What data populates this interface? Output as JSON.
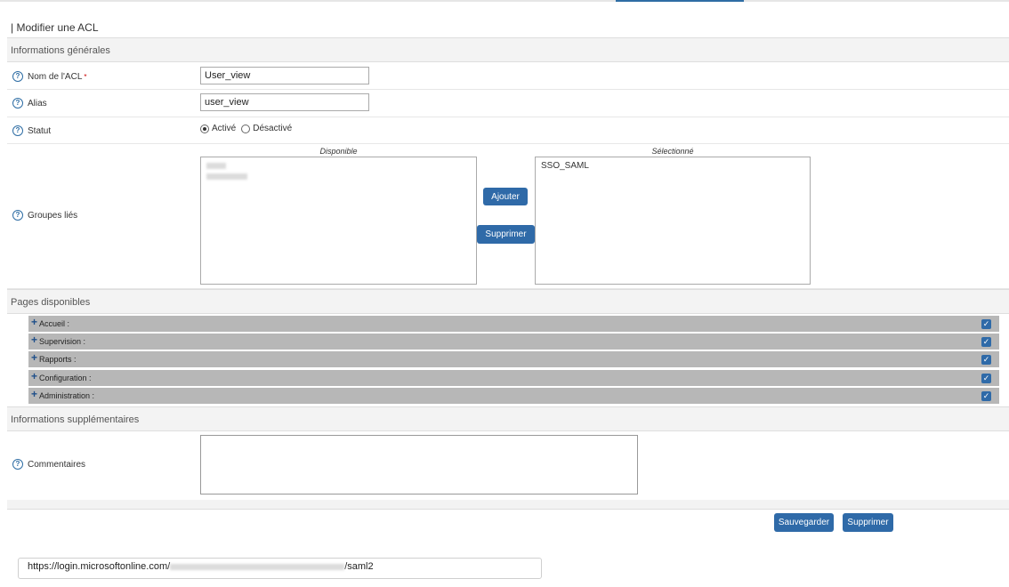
{
  "title": "| Modifier une ACL",
  "sections": {
    "general": "Informations générales",
    "pages": "Pages disponibles",
    "extra": "Informations supplémentaires"
  },
  "fields": {
    "name": {
      "label": "Nom de l'ACL",
      "required_mark": "*",
      "value": "User_view"
    },
    "alias": {
      "label": "Alias",
      "value": "user_view"
    },
    "status": {
      "label": "Statut",
      "options": [
        {
          "label": "Activé",
          "checked": true
        },
        {
          "label": "Désactivé",
          "checked": false
        }
      ]
    },
    "groups": {
      "label": "Groupes liés",
      "available_caption": "Disponible",
      "selected_caption": "Sélectionné",
      "selected_items": [
        "SSO_SAML"
      ],
      "add_button": "Ajouter",
      "remove_button": "Supprimer"
    },
    "comments": {
      "label": "Commentaires",
      "value": ""
    }
  },
  "pages": [
    {
      "label": "Accueil :",
      "checked": true
    },
    {
      "label": "Supervision :",
      "checked": true
    },
    {
      "label": "Rapports :",
      "checked": true
    },
    {
      "label": "Configuration :",
      "checked": true
    },
    {
      "label": "Administration :",
      "checked": true
    }
  ],
  "actions": {
    "save": "Sauvegarder",
    "delete": "Supprimer"
  },
  "help_icon_glyph": "?",
  "plus_glyph": "+",
  "check_glyph": "✓",
  "url": {
    "prefix": "https://login.microsoftonline.com/",
    "suffix": "/saml2"
  },
  "colors": {
    "accent": "#2f6aa8",
    "page_row_bg": "#b7b7b7",
    "section_bg": "#f3f3f3"
  }
}
